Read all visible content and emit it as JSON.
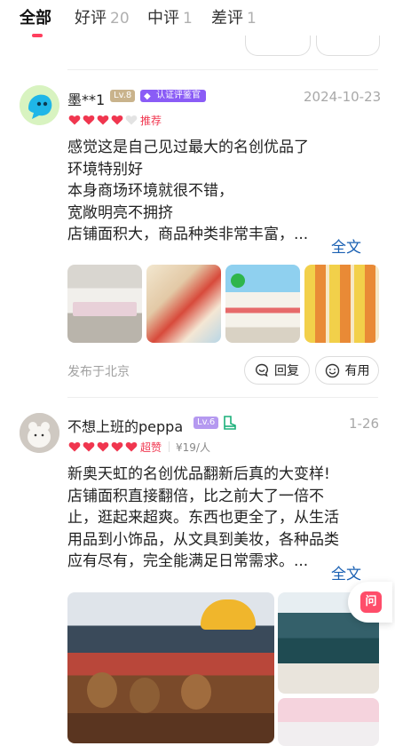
{
  "tabs": [
    {
      "label": "全部",
      "count": ""
    },
    {
      "label": "好评",
      "count": "20"
    },
    {
      "label": "中评",
      "count": "1"
    },
    {
      "label": "差评",
      "count": "1"
    }
  ],
  "reviews": [
    {
      "user": "墨**1",
      "level": "Lv.8",
      "badge": "认证评鉴官",
      "date": "2024-10-23",
      "tag": "推荐",
      "rating_hearts": 4,
      "lines": [
        "感觉这是自己见过最大的名创优品了",
        "环境特别好",
        "本身商场环境就很不错，",
        "宽敞明亮不拥挤",
        "店铺面积大，商品种类非常丰富，..."
      ],
      "more": "全文",
      "location": "发布于北京",
      "reply_label": "回复",
      "useful_label": "有用"
    },
    {
      "user": "不想上班的peppa",
      "level": "Lv.6",
      "date": "1-26",
      "tag": "超赞",
      "price": "¥19/人",
      "rating_hearts": 5,
      "lines": [
        "新奥天虹的名创优品翻新后真的大变样!",
        "店铺面积直接翻倍，比之前大了一倍不",
        "止，逛起来超爽。东西也更全了，从生活",
        "用品到小饰品，从文具到美妆，各种品类",
        "应有尽有，完全能满足日常需求。..."
      ],
      "more": "全文"
    }
  ],
  "ask_button": "问",
  "colors": {
    "accent": "#ff3f5e",
    "heart": "#f0364f",
    "link": "#1b61b3",
    "badge": "#8a5cf6"
  }
}
